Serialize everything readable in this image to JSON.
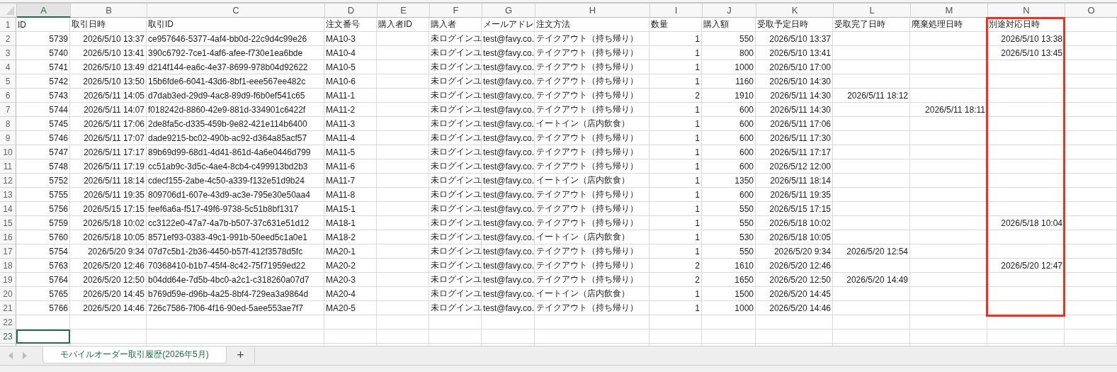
{
  "columns": [
    {
      "letter": "A",
      "selected": true,
      "highlighted": false,
      "kind": "number"
    },
    {
      "letter": "B",
      "selected": false,
      "highlighted": false,
      "kind": "date"
    },
    {
      "letter": "C",
      "selected": false,
      "highlighted": false,
      "kind": "text"
    },
    {
      "letter": "D",
      "selected": false,
      "highlighted": false,
      "kind": "text"
    },
    {
      "letter": "E",
      "selected": false,
      "highlighted": false,
      "kind": "text"
    },
    {
      "letter": "F",
      "selected": false,
      "highlighted": false,
      "kind": "text"
    },
    {
      "letter": "G",
      "selected": false,
      "highlighted": false,
      "kind": "text"
    },
    {
      "letter": "H",
      "selected": false,
      "highlighted": false,
      "kind": "text"
    },
    {
      "letter": "I",
      "selected": false,
      "highlighted": false,
      "kind": "number"
    },
    {
      "letter": "J",
      "selected": false,
      "highlighted": false,
      "kind": "number"
    },
    {
      "letter": "K",
      "selected": false,
      "highlighted": false,
      "kind": "date"
    },
    {
      "letter": "L",
      "selected": false,
      "highlighted": false,
      "kind": "date"
    },
    {
      "letter": "M",
      "selected": false,
      "highlighted": false,
      "kind": "date"
    },
    {
      "letter": "N",
      "selected": false,
      "highlighted": true,
      "kind": "date"
    },
    {
      "letter": "O",
      "selected": false,
      "highlighted": false,
      "kind": "text"
    }
  ],
  "rows": [
    {
      "number": "1",
      "kind": "header",
      "selected": false,
      "cells": {
        "A": "ID",
        "B": "取引日時",
        "C": "取引ID",
        "D": "注文番号",
        "E": "購入者ID",
        "F": "購入者",
        "G": "メールアドレ",
        "H": "注文方法",
        "I": "数量",
        "J": "購入額",
        "K": "受取予定日時",
        "L": "受取完了日時",
        "M": "廃棄処理日時",
        "N": "別途対応日時"
      }
    },
    {
      "number": "2",
      "kind": "data",
      "selected": false,
      "cells": {
        "A": "5739",
        "B": "2026/5/10 13:37",
        "C": "ce957646-5377-4af4-bb0d-22c9d4c99e26",
        "D": "MA10-3",
        "F": "未ログインユ",
        "G": "test@favy.co.",
        "H": "テイクアウト（持ち帰り）",
        "I": "1",
        "J": "550",
        "K": "2026/5/10 13:37",
        "N": "2026/5/10 13:38"
      }
    },
    {
      "number": "3",
      "kind": "data",
      "selected": false,
      "cells": {
        "A": "5740",
        "B": "2026/5/10 13:41",
        "C": "390c6792-7ce1-4af6-afee-f730e1ea6bde",
        "D": "MA10-4",
        "F": "未ログインユ",
        "G": "test@favy.co.",
        "H": "テイクアウト（持ち帰り）",
        "I": "1",
        "J": "800",
        "K": "2026/5/10 13:41",
        "N": "2026/5/10 13:45"
      }
    },
    {
      "number": "4",
      "kind": "data",
      "selected": false,
      "cells": {
        "A": "5741",
        "B": "2026/5/10 13:49",
        "C": "d214f144-ea6c-4e37-8699-978b04d92622",
        "D": "MA10-5",
        "F": "未ログインユ",
        "G": "test@favy.co.",
        "H": "テイクアウト（持ち帰り）",
        "I": "1",
        "J": "1000",
        "K": "2026/5/10 17:00"
      }
    },
    {
      "number": "5",
      "kind": "data",
      "selected": false,
      "cells": {
        "A": "5742",
        "B": "2026/5/10 13:50",
        "C": "15b6fde6-6041-43d6-8bf1-eee567ee482c",
        "D": "MA10-6",
        "F": "未ログインユ",
        "G": "test@favy.co.",
        "H": "テイクアウト（持ち帰り）",
        "I": "1",
        "J": "1160",
        "K": "2026/5/10 14:30"
      }
    },
    {
      "number": "6",
      "kind": "data",
      "selected": false,
      "cells": {
        "A": "5743",
        "B": "2026/5/11 14:05",
        "C": "d7dab3ed-29d9-4ac8-89d9-f6b0ef541c65",
        "D": "MA11-1",
        "F": "未ログインユ",
        "G": "test@favy.co.",
        "H": "テイクアウト（持ち帰り）",
        "I": "2",
        "J": "1910",
        "K": "2026/5/11 14:30",
        "L": "2026/5/11 18:12"
      }
    },
    {
      "number": "7",
      "kind": "data",
      "selected": false,
      "cells": {
        "A": "5744",
        "B": "2026/5/11 14:07",
        "C": "f018242d-8860-42e9-881d-334901c6422f",
        "D": "MA11-2",
        "F": "未ログインユ",
        "G": "test@favy.co.",
        "H": "テイクアウト（持ち帰り）",
        "I": "1",
        "J": "600",
        "K": "2026/5/11 14:30",
        "M": "2026/5/11 18:11"
      }
    },
    {
      "number": "8",
      "kind": "data",
      "selected": false,
      "cells": {
        "A": "5745",
        "B": "2026/5/11 17:06",
        "C": "2de8fa5c-d335-459b-9e82-421e114b6400",
        "D": "MA11-3",
        "F": "未ログインユ",
        "G": "test@favy.co.",
        "H": "イートイン（店内飲食）",
        "I": "1",
        "J": "600",
        "K": "2026/5/11 17:06"
      }
    },
    {
      "number": "9",
      "kind": "data",
      "selected": false,
      "cells": {
        "A": "5746",
        "B": "2026/5/11 17:07",
        "C": "dade9215-bc02-490b-ac92-d364a85acf57",
        "D": "MA11-4",
        "F": "未ログインユ",
        "G": "test@favy.co.",
        "H": "テイクアウト（持ち帰り）",
        "I": "1",
        "J": "600",
        "K": "2026/5/11 17:30"
      }
    },
    {
      "number": "10",
      "kind": "data",
      "selected": false,
      "cells": {
        "A": "5747",
        "B": "2026/5/11 17:17",
        "C": "89b69d99-68d1-4d41-861d-4a6e0446d799",
        "D": "MA11-5",
        "F": "未ログインユ",
        "G": "test@favy.co.",
        "H": "テイクアウト（持ち帰り）",
        "I": "1",
        "J": "600",
        "K": "2026/5/11 17:17"
      }
    },
    {
      "number": "11",
      "kind": "data",
      "selected": false,
      "cells": {
        "A": "5748",
        "B": "2026/5/11 17:19",
        "C": "cc51ab9c-3d5c-4ae4-8cb4-c499913bd2b3",
        "D": "MA11-6",
        "F": "未ログインユ",
        "G": "test@favy.co.",
        "H": "テイクアウト（持ち帰り）",
        "I": "1",
        "J": "600",
        "K": "2026/5/12 12:00"
      }
    },
    {
      "number": "12",
      "kind": "data",
      "selected": false,
      "cells": {
        "A": "5752",
        "B": "2026/5/11 18:14",
        "C": "cdecf155-2abe-4c50-a339-f132e51d9b24",
        "D": "MA11-7",
        "F": "未ログインユ",
        "G": "test@favy.co.",
        "H": "イートイン（店内飲食）",
        "I": "1",
        "J": "1350",
        "K": "2026/5/11 18:14"
      }
    },
    {
      "number": "13",
      "kind": "data",
      "selected": false,
      "cells": {
        "A": "5755",
        "B": "2026/5/11 19:35",
        "C": "809706d1-607e-43d9-ac3e-795e30e50aa4",
        "D": "MA11-8",
        "F": "未ログインユ",
        "G": "test@favy.co.",
        "H": "テイクアウト（持ち帰り）",
        "I": "1",
        "J": "600",
        "K": "2026/5/11 19:35"
      }
    },
    {
      "number": "14",
      "kind": "data",
      "selected": false,
      "cells": {
        "A": "5756",
        "B": "2026/5/15 17:15",
        "C": "feef6a6a-f517-49f6-9738-5c51b8bf1317",
        "D": "MA15-1",
        "F": "未ログインユ",
        "G": "test@favy.co.",
        "H": "テイクアウト（持ち帰り）",
        "I": "1",
        "J": "550",
        "K": "2026/5/15 17:15"
      }
    },
    {
      "number": "15",
      "kind": "data",
      "selected": false,
      "cells": {
        "A": "5759",
        "B": "2026/5/18 10:02",
        "C": "cc3122e0-47a7-4a7b-b507-37c631e51d12",
        "D": "MA18-1",
        "F": "未ログインユ",
        "G": "test@favy.co.",
        "H": "テイクアウト（持ち帰り）",
        "I": "1",
        "J": "550",
        "K": "2026/5/18 10:02",
        "N": "2026/5/18 10:04"
      }
    },
    {
      "number": "16",
      "kind": "data",
      "selected": false,
      "cells": {
        "A": "5760",
        "B": "2026/5/18 10:05",
        "C": "8571ef93-0383-49c1-991b-50eed5c1a0e1",
        "D": "MA18-2",
        "F": "未ログインユ",
        "G": "test@favy.co.",
        "H": "イートイン（店内飲食）",
        "I": "1",
        "J": "530",
        "K": "2026/5/18 10:05"
      }
    },
    {
      "number": "17",
      "kind": "data",
      "selected": false,
      "cells": {
        "A": "5754",
        "B": "2026/5/20 9:34",
        "C": "07d7c5b1-2b36-4450-b57f-412f3578d5fc",
        "D": "MA20-1",
        "F": "未ログインユ",
        "G": "test@favy.co.",
        "H": "テイクアウト（持ち帰り）",
        "I": "1",
        "J": "550",
        "K": "2026/5/20 9:34",
        "L": "2026/5/20 12:54"
      }
    },
    {
      "number": "18",
      "kind": "data",
      "selected": false,
      "cells": {
        "A": "5763",
        "B": "2026/5/20 12:46",
        "C": "70368410-b1b7-45f4-8c42-75f71959ed22",
        "D": "MA20-2",
        "F": "未ログインユ",
        "G": "test@favy.co.",
        "H": "テイクアウト（持ち帰り）",
        "I": "2",
        "J": "1610",
        "K": "2026/5/20 12:46",
        "N": "2026/5/20 12:47"
      }
    },
    {
      "number": "19",
      "kind": "data",
      "selected": false,
      "cells": {
        "A": "5764",
        "B": "2026/5/20 12:50",
        "C": "b04dd64e-7d5b-4bc0-a2c1-c318260a07d7",
        "D": "MA20-3",
        "F": "未ログインユ",
        "G": "test@favy.co.",
        "H": "テイクアウト（持ち帰り）",
        "I": "2",
        "J": "1650",
        "K": "2026/5/20 12:50",
        "L": "2026/5/20 14:49"
      }
    },
    {
      "number": "20",
      "kind": "data",
      "selected": false,
      "cells": {
        "A": "5765",
        "B": "2026/5/20 14:45",
        "C": "b769d59e-d96b-4a25-8bf4-729ea3a9864d",
        "D": "MA20-4",
        "F": "未ログインユ",
        "G": "test@favy.co.",
        "H": "イートイン（店内飲食）",
        "I": "1",
        "J": "1500",
        "K": "2026/5/20 14:45"
      }
    },
    {
      "number": "21",
      "kind": "data",
      "selected": false,
      "cells": {
        "A": "5766",
        "B": "2026/5/20 14:46",
        "C": "726c7586-7f06-4f16-90ed-5aee553ae7f7",
        "D": "MA20-5",
        "F": "未ログインユ",
        "G": "test@favy.co.",
        "H": "テイクアウト（持ち帰り）",
        "I": "1",
        "J": "1000",
        "K": "2026/5/20 14:46"
      }
    },
    {
      "number": "22",
      "kind": "data",
      "selected": false,
      "cells": {}
    },
    {
      "number": "23",
      "kind": "data",
      "selected": true,
      "cells": {}
    }
  ],
  "sheet_tabs": [
    {
      "label": "モバイルオーダー取引履歴(2026年5月)",
      "selected": true
    }
  ],
  "add_sheet": "+"
}
